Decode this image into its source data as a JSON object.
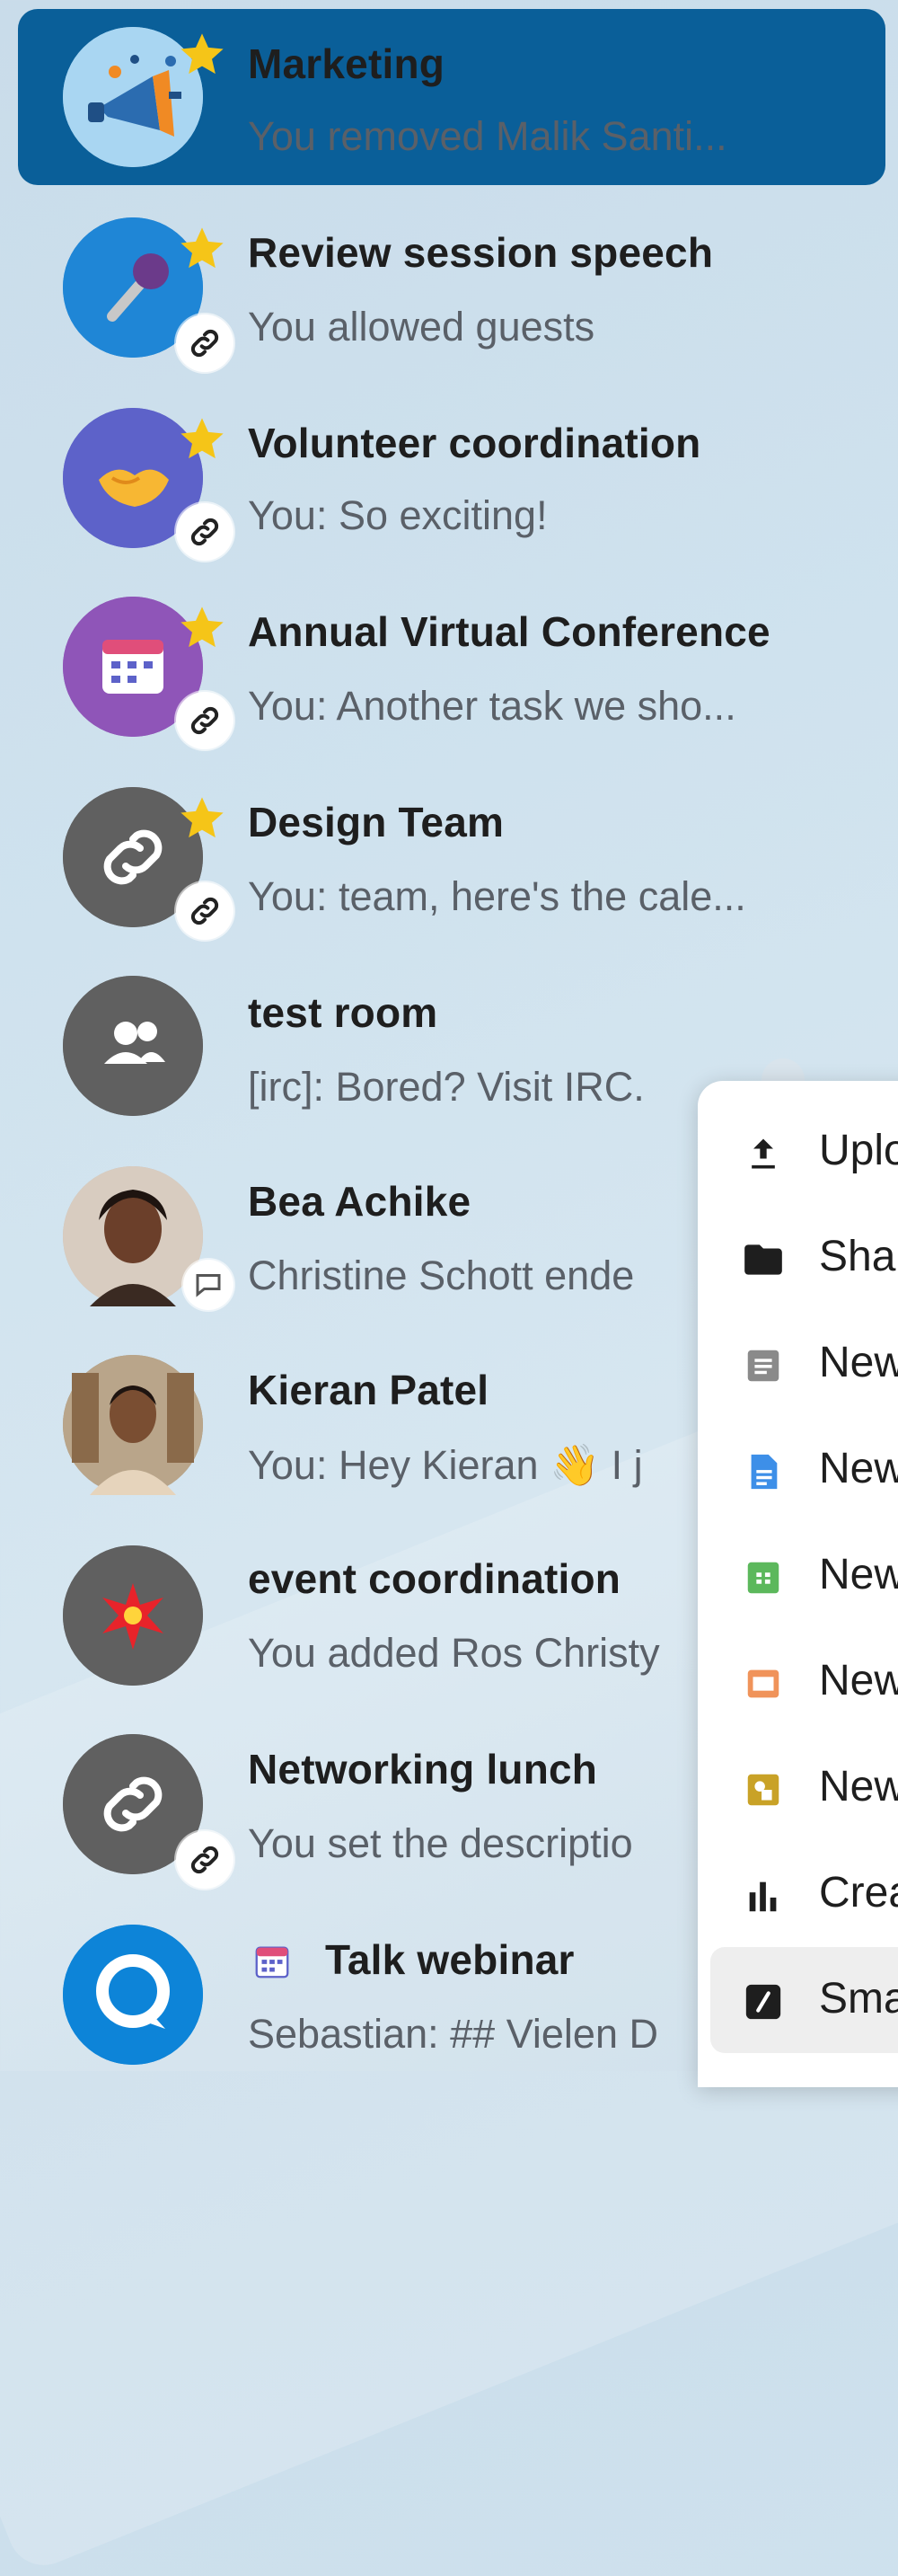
{
  "conversations": [
    {
      "name": "Marketing",
      "last_message": "You removed Malik Santi...",
      "favorite": true,
      "link": false,
      "active": true,
      "avatar": "megaphone-icon"
    },
    {
      "name": "Review session speech",
      "last_message": "You allowed guests",
      "favorite": true,
      "link": true,
      "avatar": "microphone-icon"
    },
    {
      "name": "Volunteer coordination",
      "last_message": "You: So exciting!",
      "favorite": true,
      "link": true,
      "avatar": "handshake-icon"
    },
    {
      "name": "Annual Virtual Conference",
      "last_message": "You: Another task we sho...",
      "favorite": true,
      "link": true,
      "avatar": "calendar-icon"
    },
    {
      "name": "Design Team",
      "last_message": "You: team, here's the cale...",
      "favorite": true,
      "link": true,
      "avatar": "link-icon"
    },
    {
      "name": "test room",
      "last_message": "[irc]: Bored? Visit IRC.",
      "favorite": false,
      "link": false,
      "avatar": "group-icon"
    },
    {
      "name": "Bea Achike",
      "last_message": "Christine Schott ende",
      "favorite": false,
      "link": false,
      "avatar": "user-photo"
    },
    {
      "name": "Kieran Patel",
      "last_message": "You: Hey Kieran 👋 I j",
      "favorite": false,
      "link": false,
      "avatar": "user-photo"
    },
    {
      "name": "event coordination",
      "last_message": "You added Ros Christy",
      "favorite": false,
      "link": false,
      "avatar": "burst-icon"
    },
    {
      "name": "Networking lunch",
      "last_message": "You set the descriptio",
      "favorite": false,
      "link": true,
      "avatar": "link-icon"
    },
    {
      "name": "Talk webinar",
      "last_message": "Sebastian: ## Vielen D",
      "favorite": false,
      "link": false,
      "avatar": "talk-icon",
      "title_prefix_icon": "calendar-icon"
    }
  ],
  "menu": {
    "items": [
      {
        "label": "Uplo",
        "icon": "upload-icon"
      },
      {
        "label": "Sha",
        "icon": "folder-icon"
      },
      {
        "label": "New",
        "icon": "text-document-icon"
      },
      {
        "label": "New",
        "icon": "document-icon"
      },
      {
        "label": "New",
        "icon": "spreadsheet-icon"
      },
      {
        "label": "New",
        "icon": "presentation-icon"
      },
      {
        "label": "New",
        "icon": "diagram-icon"
      },
      {
        "label": "Crea",
        "icon": "poll-icon"
      },
      {
        "label": "Sma",
        "icon": "smart-picker-icon"
      }
    ]
  },
  "colors": {
    "active_row": "#0a5f99",
    "star": "#f5c518",
    "avatar_gray": "#5f5f5f"
  }
}
